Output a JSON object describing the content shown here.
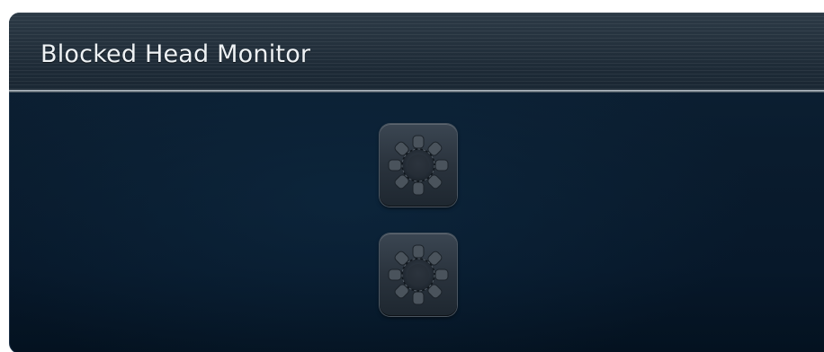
{
  "window": {
    "title": "Blocked Head Monitor"
  },
  "buttons": [
    {
      "icon": "fan-icon"
    },
    {
      "icon": "fan-icon"
    }
  ],
  "colors": {
    "panel_background": "#0a1c2e",
    "header_background": "#24313d",
    "title_text": "#eef2f5",
    "divider": "#b9c2ca",
    "button_face": "#2a333d"
  }
}
